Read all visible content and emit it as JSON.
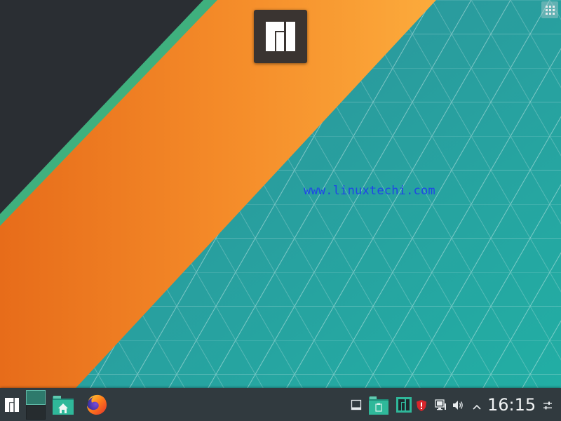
{
  "desktop": {
    "watermark_text": "www.linuxtechi.com",
    "colors": {
      "dark_triangle": "#2a2e33",
      "green_stripe": "#3fb07e",
      "orange_band_start": "#e86f1b",
      "orange_band_end": "#fba83a",
      "teal_background": "#2a9e99",
      "logo_tile": "#3a3431",
      "watermark": "#1f47e6"
    },
    "icons": {
      "toolbox": "grid-menu-icon",
      "center_logo": "manjaro-logo-icon"
    }
  },
  "taskbar": {
    "colors": {
      "background": "#313a3f",
      "accent": "#2fb89a"
    },
    "launcher_icon": "manjaro-logo-icon",
    "pinned": [
      {
        "name": "file-manager",
        "icon": "folder-home-icon"
      },
      {
        "name": "web-browser",
        "icon": "firefox-icon"
      }
    ],
    "tray_icons": [
      "show-desktop-icon",
      "clipboard-folder-icon",
      "manjaro-settings-icon",
      "update-shield-icon",
      "network-icon",
      "volume-icon",
      "expand-tray-icon"
    ],
    "clock": {
      "time": "16:15"
    },
    "panel_settings_icon": "panel-options-icon"
  }
}
